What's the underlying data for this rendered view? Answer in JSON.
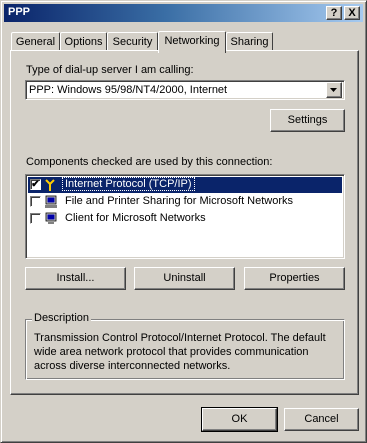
{
  "window": {
    "title": "PPP"
  },
  "titlebar_buttons": {
    "help": "?",
    "close": "X"
  },
  "tabs": [
    {
      "label": "General",
      "access_key": "G",
      "active": false
    },
    {
      "label": "Options",
      "access_key": "O",
      "active": false
    },
    {
      "label": "Security",
      "access_key": "S",
      "active": false
    },
    {
      "label": "Networking",
      "access_key": "N",
      "active": true
    },
    {
      "label": "Sharing",
      "access_key": "h",
      "active": false
    }
  ],
  "networking": {
    "server_type_label": "Type of dial-up server I am calling:",
    "server_type_value": "PPP: Windows 95/98/NT4/2000, Internet",
    "settings_button": "Settings",
    "components_label": "Components checked are used by this connection:",
    "components": [
      {
        "label": "Internet Protocol (TCP/IP)",
        "checked": true,
        "selected": true,
        "icon": "protocol-icon"
      },
      {
        "label": "File and Printer Sharing for Microsoft Networks",
        "checked": false,
        "selected": false,
        "icon": "service-icon"
      },
      {
        "label": "Client for Microsoft Networks",
        "checked": false,
        "selected": false,
        "icon": "client-icon"
      }
    ],
    "install_button": "Install...",
    "uninstall_button": "Uninstall",
    "properties_button": "Properties",
    "description_title": "Description",
    "description_lines": [
      "Transmission Control Protocol/Internet Protocol. The default",
      "wide area network protocol that provides communication",
      "across diverse interconnected networks."
    ]
  },
  "footer": {
    "ok_button": "OK",
    "cancel_button": "Cancel"
  }
}
